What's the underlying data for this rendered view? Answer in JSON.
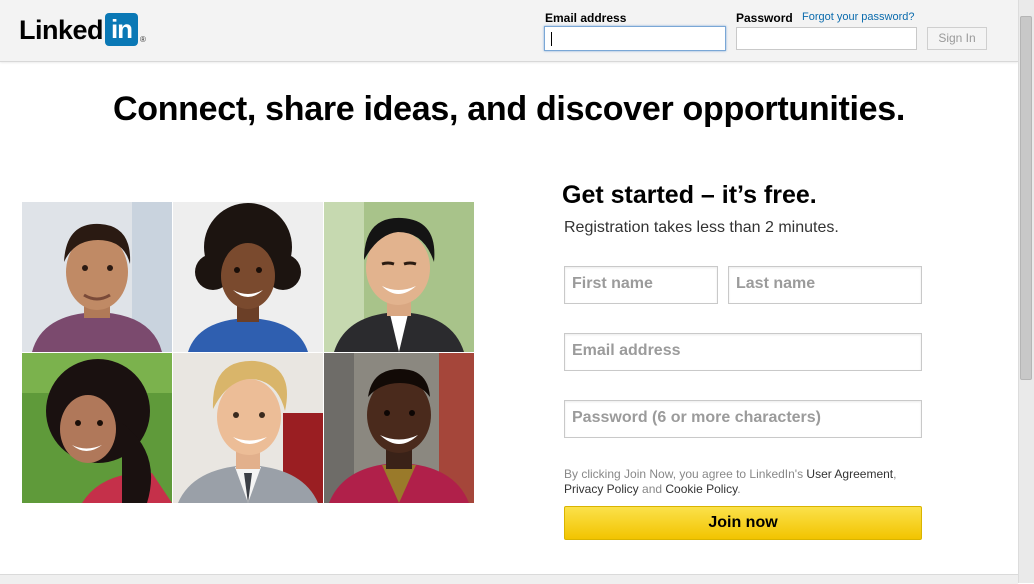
{
  "header": {
    "logo_text": "Linked",
    "logo_box": "in",
    "logo_reg": "®",
    "email_label": "Email address",
    "password_label": "Password",
    "forgot_link": "Forgot your password?",
    "signin_button": "Sign In",
    "email_value": "",
    "password_value": ""
  },
  "headline": "Connect, share ideas, and discover opportunities.",
  "photos": [
    {
      "name": "photo-man-smiling"
    },
    {
      "name": "photo-woman-curly-hair"
    },
    {
      "name": "photo-man-suit"
    },
    {
      "name": "photo-woman-grass"
    },
    {
      "name": "photo-man-blond"
    },
    {
      "name": "photo-man-red-jacket"
    }
  ],
  "signup": {
    "title": "Get started – it’s free.",
    "subtitle": "Registration takes less than 2 minutes.",
    "first_name_placeholder": "First name",
    "last_name_placeholder": "Last name",
    "email_placeholder": "Email address",
    "password_placeholder": "Password (6 or more characters)",
    "legal_prefix": "By clicking Join Now, you agree to LinkedIn's ",
    "user_agreement": "User Agreement",
    "legal_comma": ",",
    "privacy_policy": "Privacy Policy",
    "legal_and": " and ",
    "cookie_policy": "Cookie Policy",
    "legal_end": ".",
    "join_button": "Join now"
  },
  "colors": {
    "brand_blue": "#0a78b5",
    "link_blue": "#0a6bad",
    "join_yellow": "#f5ce1a"
  }
}
